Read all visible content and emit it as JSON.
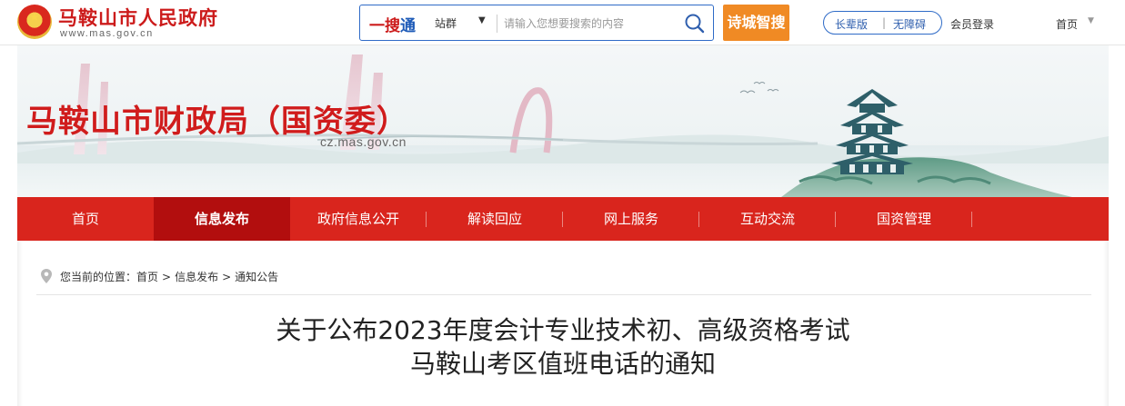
{
  "top": {
    "site_name": "马鞍山市人民政府",
    "site_url": "www.mas.gov.cn",
    "search": {
      "logo_prefix": "一搜",
      "logo_suffix": "通",
      "scope": "站群",
      "placeholder": "请输入您想要搜索的内容"
    },
    "shicheng_button": "诗城智搜",
    "accessibility": {
      "elder": "长辈版",
      "separator": "|",
      "barrier_free": "无障碍"
    },
    "login": "会员登录",
    "home_menu": "首页",
    "colors": {
      "brand_red": "#cc1b1b",
      "search_blue": "#2f6bc7",
      "orange": "#f08a24"
    }
  },
  "banner": {
    "title": "马鞍山市财政局（国资委）",
    "url": "cz.mas.gov.cn"
  },
  "nav": {
    "items": [
      {
        "label": "首页",
        "active": false
      },
      {
        "label": "信息发布",
        "active": true
      },
      {
        "label": "政府信息公开",
        "active": false
      },
      {
        "label": "解读回应",
        "active": false
      },
      {
        "label": "网上服务",
        "active": false
      },
      {
        "label": "互动交流",
        "active": false
      },
      {
        "label": "国资管理",
        "active": false
      }
    ],
    "color": "#d9251d",
    "active_color": "#b20e0e"
  },
  "breadcrumb": {
    "prefix": "您当前的位置：",
    "items": [
      "首页",
      "信息发布",
      "通知公告"
    ],
    "separator": ">"
  },
  "article": {
    "title_line1": "关于公布2023年度会计专业技术初、高级资格考试",
    "title_line2": "马鞍山考区值班电话的通知"
  }
}
